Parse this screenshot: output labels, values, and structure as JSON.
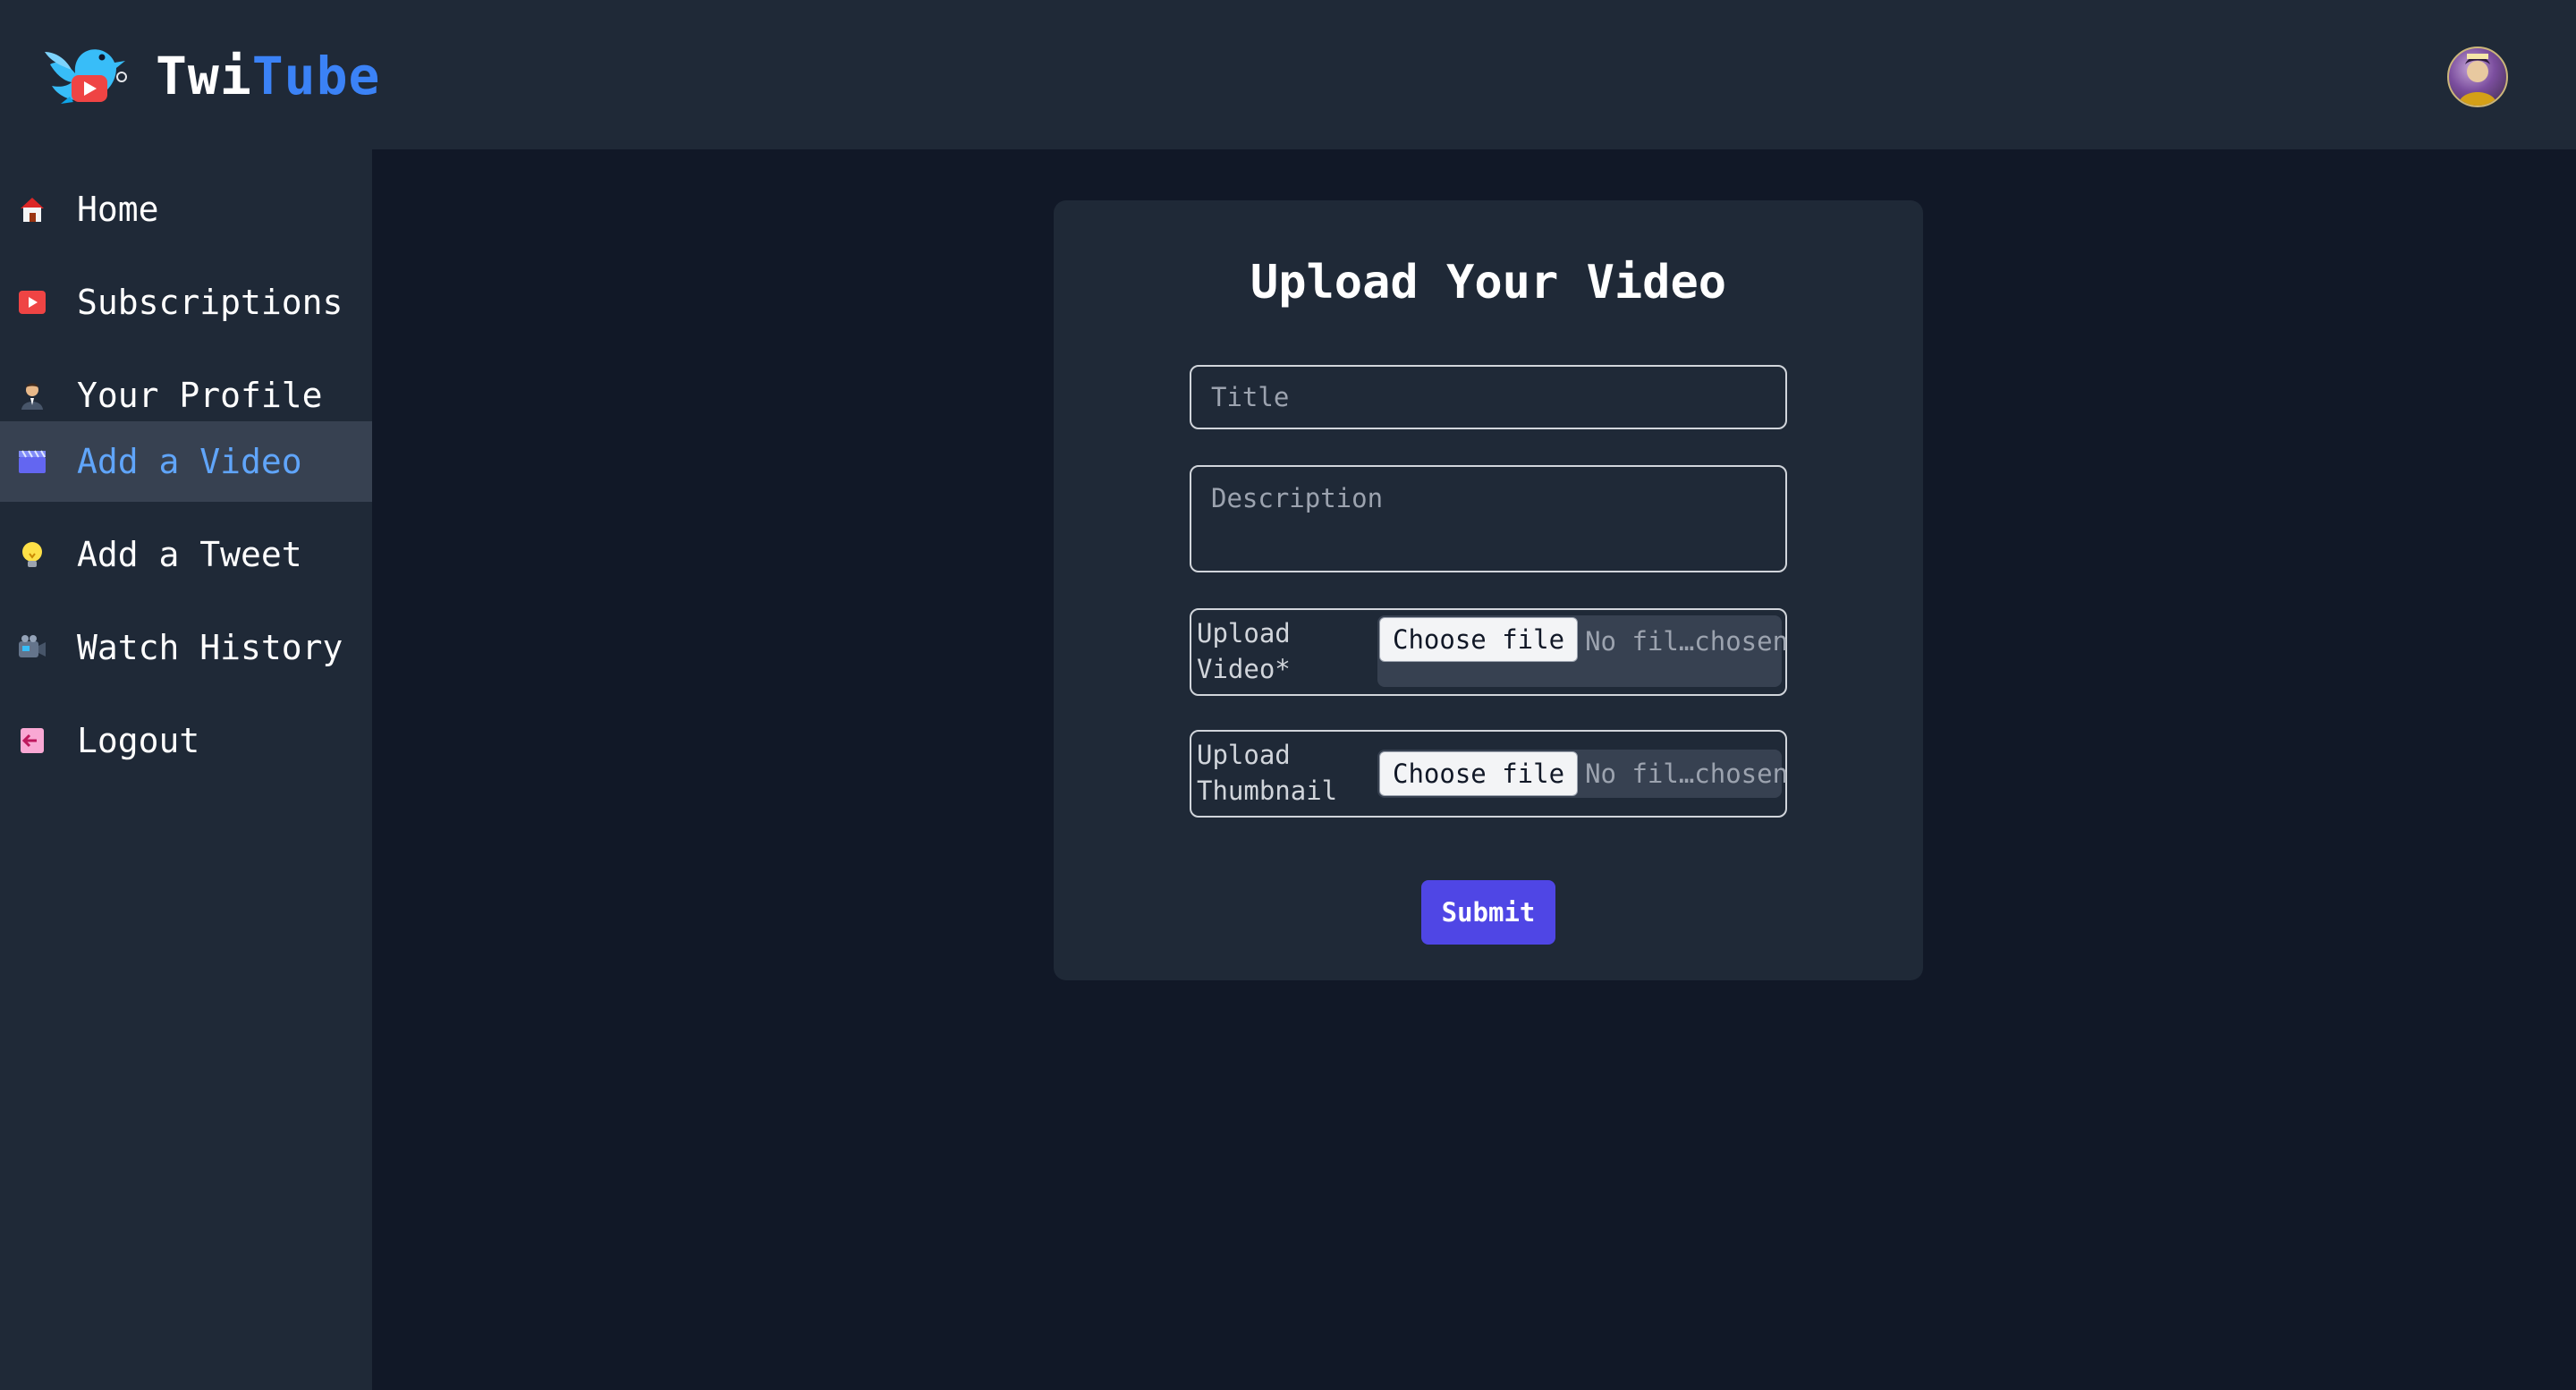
{
  "app": {
    "brand_part1": "Twi",
    "brand_part2": "Tube",
    "brand_color": "#3b82f6",
    "logo_icon": "bird-play-icon",
    "avatar_icon": "user-avatar"
  },
  "sidebar": {
    "items": [
      {
        "label": "Home",
        "icon": "house-icon",
        "active": false
      },
      {
        "label": "Subscriptions",
        "icon": "play-button-icon",
        "active": false
      },
      {
        "label": "Your Profile",
        "icon": "person-icon",
        "active": false
      },
      {
        "label": "Add a Video",
        "icon": "clapperboard-icon",
        "active": true
      },
      {
        "label": "Add a Tweet",
        "icon": "lightbulb-icon",
        "active": false
      },
      {
        "label": "Watch History",
        "icon": "video-camera-icon",
        "active": false
      },
      {
        "label": "Logout",
        "icon": "logout-icon",
        "active": false
      }
    ],
    "active_color": "#60a5fa"
  },
  "form": {
    "title": "Upload Your Video",
    "title_placeholder": "Title",
    "description_placeholder": "Description",
    "video_label": "Upload\nVideo*",
    "thumbnail_label": "Upload\nThumbnail",
    "choose_file_label": "Choose file",
    "no_file_text": "No fil…chosen",
    "submit_label": "Submit",
    "submit_color": "#4f46e5"
  }
}
